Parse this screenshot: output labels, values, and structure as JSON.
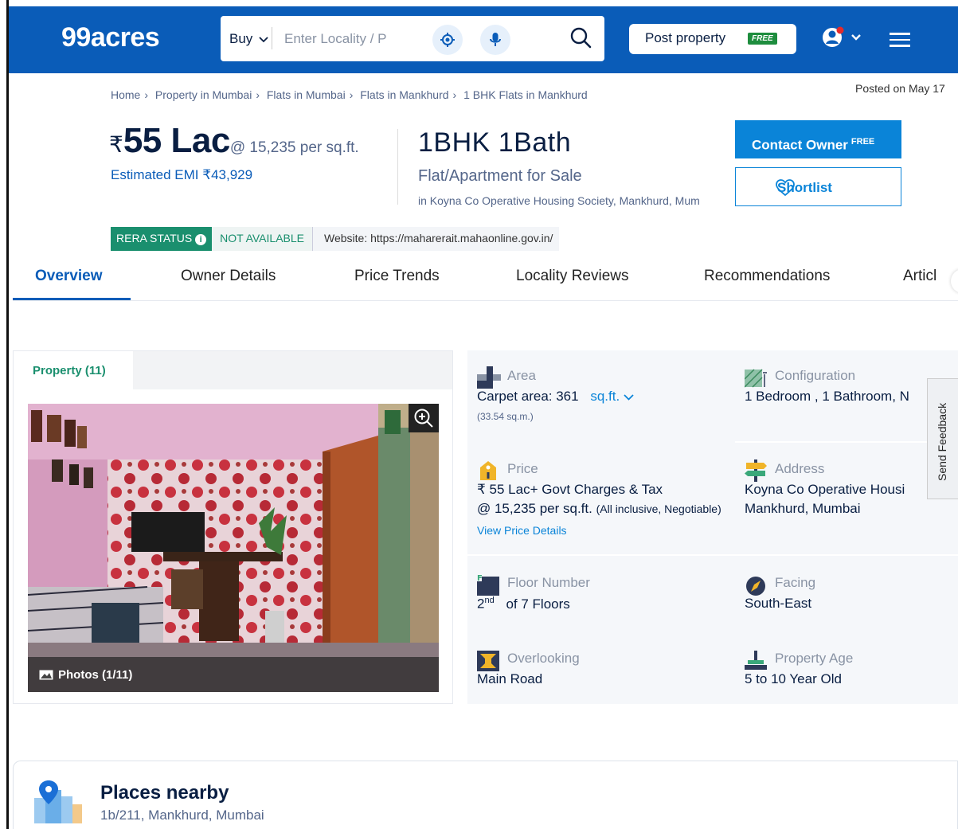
{
  "header": {
    "logo": "99acres",
    "search_mode": "Buy",
    "search_placeholder": "Enter Locality / P",
    "post_property_label": "Post property",
    "post_property_badge": "FREE"
  },
  "breadcrumb": [
    "Home",
    "Property in Mumbai",
    "Flats in Mumbai",
    "Flats in Mankhurd",
    "1 BHK Flats in Mankhurd"
  ],
  "posted_on": "Posted on May 17",
  "price": {
    "currency": "₹",
    "amount": "55 Lac",
    "per_sqft": "@ 15,235 per sq.ft.",
    "emi": "Estimated EMI ₹43,929"
  },
  "listing": {
    "config": "1BHK 1Bath",
    "type": "Flat/Apartment for Sale",
    "society": "in Koyna Co Operative Housing Society, Mankhurd, Mum"
  },
  "actions": {
    "contact_label": "Contact Owner",
    "contact_badge": "FREE",
    "shortlist_label": "Shortlist"
  },
  "rera": {
    "status_label": "RERA STATUS",
    "status_value": "NOT AVAILABLE",
    "website": "Website: https://maharerait.mahaonline.gov.in/"
  },
  "tabs": [
    "Overview",
    "Owner Details",
    "Price Trends",
    "Locality Reviews",
    "Recommendations",
    "Articl"
  ],
  "photos": {
    "tab_label": "Property (11)",
    "caption": "Photos (1/11)"
  },
  "details": {
    "area": {
      "label": "Area",
      "value": "Carpet area: 361",
      "unit": "sq.ft.",
      "sub": "(33.54 sq.m.)"
    },
    "configuration": {
      "label": "Configuration",
      "value": "1 Bedroom , 1 Bathroom, N"
    },
    "price": {
      "label": "Price",
      "value": "₹ 55 Lac+ Govt Charges & Tax",
      "value2": "@ 15,235 per sq.ft.",
      "note": "(All inclusive, Negotiable)",
      "link": "View Price Details"
    },
    "address": {
      "label": "Address",
      "value": "Koyna Co Operative Housi",
      "value2": "Mankhurd, Mumbai"
    },
    "floor": {
      "label": "Floor Number",
      "value_num": "2",
      "value_sup": "nd",
      "value_rest": "of 7 Floors"
    },
    "facing": {
      "label": "Facing",
      "value": "South-East"
    },
    "overlooking": {
      "label": "Overlooking",
      "value": "Main Road"
    },
    "age": {
      "label": "Property Age",
      "value": "5 to 10 Year Old"
    }
  },
  "feedback_label": "Send Feedback",
  "places": {
    "title": "Places nearby",
    "address": "1b/211, Mankhurd, Mumbai"
  },
  "colors": {
    "brand": "#0a5cb8",
    "cta": "#0a84d8",
    "rera": "#1a8f6e"
  }
}
